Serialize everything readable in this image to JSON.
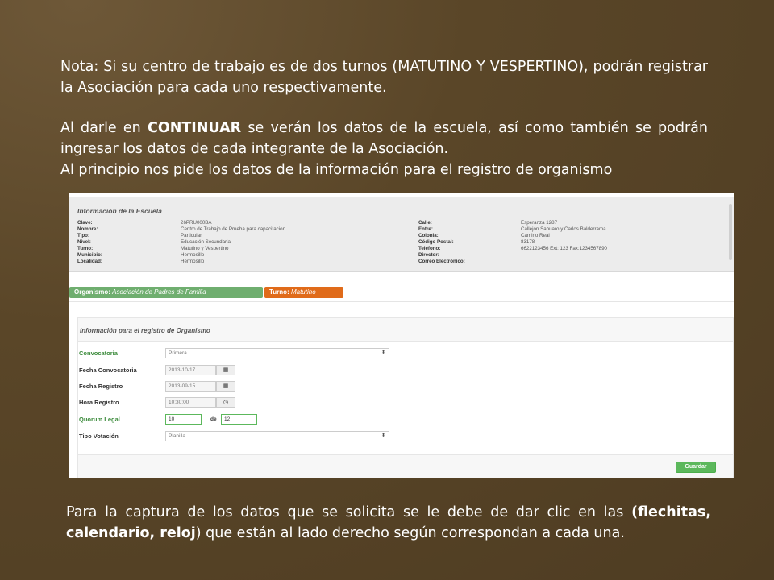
{
  "slide": {
    "p1_part1": "Nota:     Si su centro de trabajo es de dos turnos (MATUTINO Y VESPERTINO), podrán registrar la Asociación para cada uno respectivamente.",
    "p2_part1": "Al darle en ",
    "p2_bold": "CONTINUAR",
    "p2_part2": " se verán  los datos de la escuela, así como también se podrán ingresar los datos de cada integrante de la Asociación.",
    "p2_line3": "Al principio nos pide los datos de la información para el registro de organismo",
    "p3_part1": "Para la captura de los datos  que se solicita se le debe de dar clic en las  ",
    "p3_bold1": "(flechitas, calendario, reloj",
    "p3_part2": ") que están al lado derecho según correspondan a cada una."
  },
  "school": {
    "title": "Información de la Escuela",
    "left_labels": [
      "Clave:",
      "Nombre:",
      "Tipo:",
      "Nivel:",
      "Turno:",
      "Municipio:",
      "Localidad:"
    ],
    "left_values": [
      "26PRU000BA",
      "Centro de Trabajo de Prueba para capacitacion",
      "Particular",
      "Educación Secundaria",
      "Matutino y Vespertino",
      "Hermosillo",
      "Hermosillo"
    ],
    "right_labels": [
      "Calle:",
      "Entre:",
      "Colonia:",
      "Código Postal:",
      "Teléfono:",
      "Director:",
      "Correo Electrónico:"
    ],
    "right_values": [
      "Esperanza 1287",
      "Callejón Sahuaro y Carlos Balderrama",
      "Camino Real",
      "83178",
      "6622123456 Ext: 123 Fax:1234567890",
      "",
      ""
    ]
  },
  "badges": {
    "org_label": "Organismo:",
    "org_value": "Asociación de Padres de Familia",
    "turno_label": "Turno:",
    "turno_value": "Matutino"
  },
  "form": {
    "title": "Información para el registro de Organismo",
    "convocatoria_label": "Convocatoria",
    "convocatoria_value": "Primera",
    "fecha_convocatoria_label": "Fecha Convocatoria",
    "fecha_convocatoria_value": "2013-10-17",
    "fecha_registro_label": "Fecha Registro",
    "fecha_registro_value": "2013-09-15",
    "hora_registro_label": "Hora Registro",
    "hora_registro_value": "10:30:00",
    "quorum_label": "Quorum Legal",
    "quorum_value": "10",
    "quorum_de": "de",
    "quorum_total": "12",
    "tipo_votacion_label": "Tipo Votación",
    "tipo_votacion_value": "Planilla",
    "save_label": "Guardar"
  },
  "icons": {
    "select_arrow": "updown-arrows-icon",
    "calendar": "calendar-icon",
    "clock": "clock-icon"
  },
  "colors": {
    "background": "#5a4628",
    "green_badge": "#6fae6f",
    "orange_badge": "#e06b1a",
    "save_button": "#5cb85c"
  }
}
